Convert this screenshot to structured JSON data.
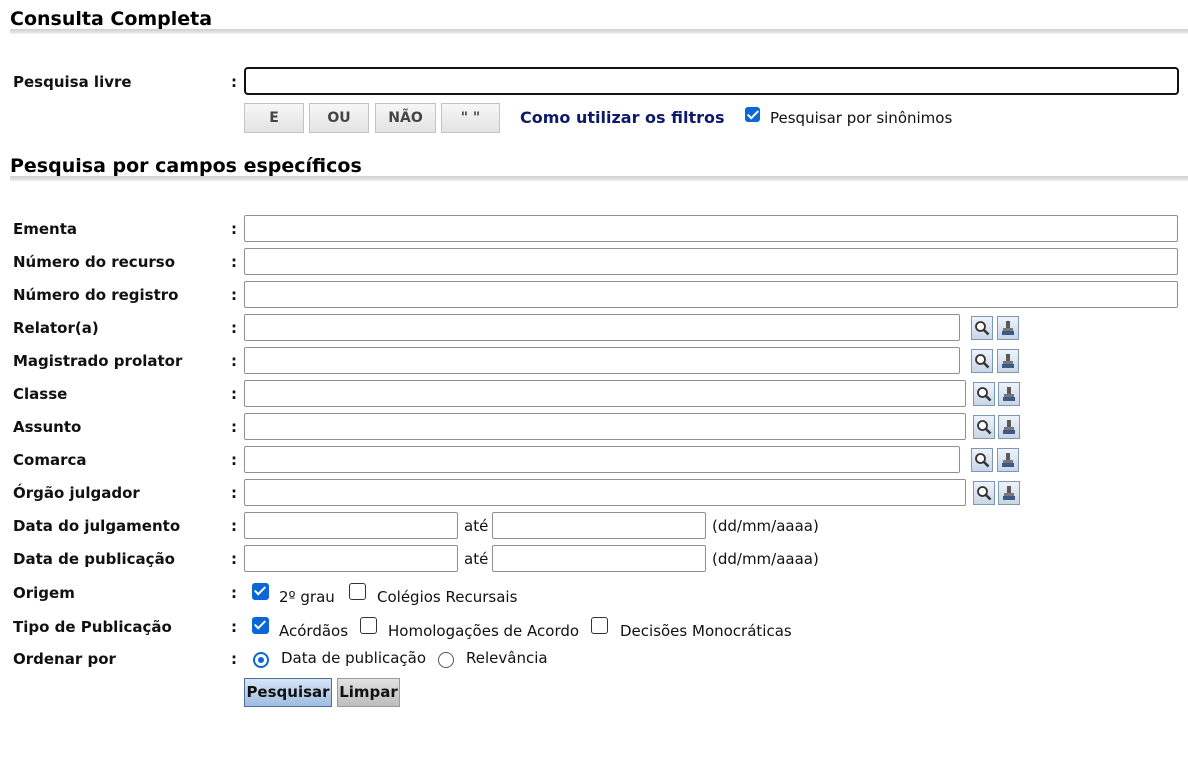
{
  "sections": {
    "consulta_completa": "Consulta Completa",
    "campos_especificos": "Pesquisa por campos específicos"
  },
  "colon": ":",
  "pesquisa_livre": {
    "label": "Pesquisa livre",
    "value": "",
    "operators": [
      "E",
      "OU",
      "NÃO",
      "\" \""
    ],
    "filters_link": "Como utilizar os filtros",
    "synonyms": {
      "label": "Pesquisar por sinônimos",
      "checked": true
    }
  },
  "fields": {
    "ementa": "Ementa",
    "numero_recurso": "Número do recurso",
    "numero_registro": "Número do registro",
    "relator": "Relator(a)",
    "magistrado": "Magistrado prolator",
    "classe": "Classe",
    "assunto": "Assunto",
    "comarca": "Comarca",
    "orgao": "Órgão julgador",
    "data_julgamento": "Data do julgamento",
    "data_publicacao": "Data de publicação",
    "origem": "Origem",
    "tipo_publicacao": "Tipo de Publicação",
    "ordenar": "Ordenar por"
  },
  "date": {
    "ate": "até",
    "format": "(dd/mm/aaaa)"
  },
  "origem": [
    {
      "label": "2º grau",
      "checked": true
    },
    {
      "label": "Colégios Recursais",
      "checked": false
    }
  ],
  "tipo_publicacao": [
    {
      "label": "Acórdãos",
      "checked": true
    },
    {
      "label": "Homologações de Acordo",
      "checked": false
    },
    {
      "label": "Decisões Monocráticas",
      "checked": false
    }
  ],
  "ordenar": [
    {
      "label": "Data de publicação",
      "selected": true
    },
    {
      "label": "Relevância",
      "selected": false
    }
  ],
  "icons": {
    "search": "magnifier-icon",
    "clear": "eraser-icon"
  },
  "actions": {
    "search": "Pesquisar",
    "clear": "Limpar"
  }
}
